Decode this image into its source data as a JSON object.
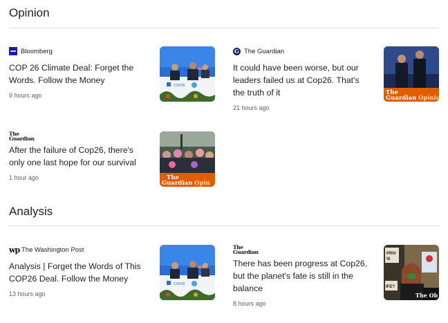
{
  "sections": {
    "opinion": {
      "title": "Opinion",
      "articles": [
        {
          "source": "Bloomberg",
          "headline": "COP 26 Climate Deal: Forget the Words. Follow the Money",
          "time": "9 hours ago"
        },
        {
          "source": "The Guardian",
          "headline": "It could have been worse, but our leaders failed us at Cop26. That's the truth of it",
          "time": "21 hours ago",
          "thumb_overlay": "The Guardian Opinion"
        },
        {
          "source_logo_text": "The Guardian",
          "headline": "After the failure of Cop26, there's only one last hope for our survival",
          "time": "1 hour ago",
          "thumb_overlay": "The Guardian Opinion"
        }
      ]
    },
    "analysis": {
      "title": "Analysis",
      "articles": [
        {
          "source": "The Washington Post",
          "headline": "Analysis | Forget the Words of This COP26 Deal. Follow the Money",
          "time": "13 hours ago"
        },
        {
          "source_logo_text": "The Guardian",
          "headline": "There has been progress at Cop26, but the planet's fate is still in the balance",
          "time": "8 hours ago",
          "thumb_overlay": "The Ob"
        }
      ]
    }
  },
  "colors": {
    "guardian_navy": "#052962",
    "guardian_opinion_orange": "#e05e00",
    "bloomberg_blue": "#1a1aa6",
    "divider": "#dadce0",
    "muted_text": "#5f6368"
  }
}
